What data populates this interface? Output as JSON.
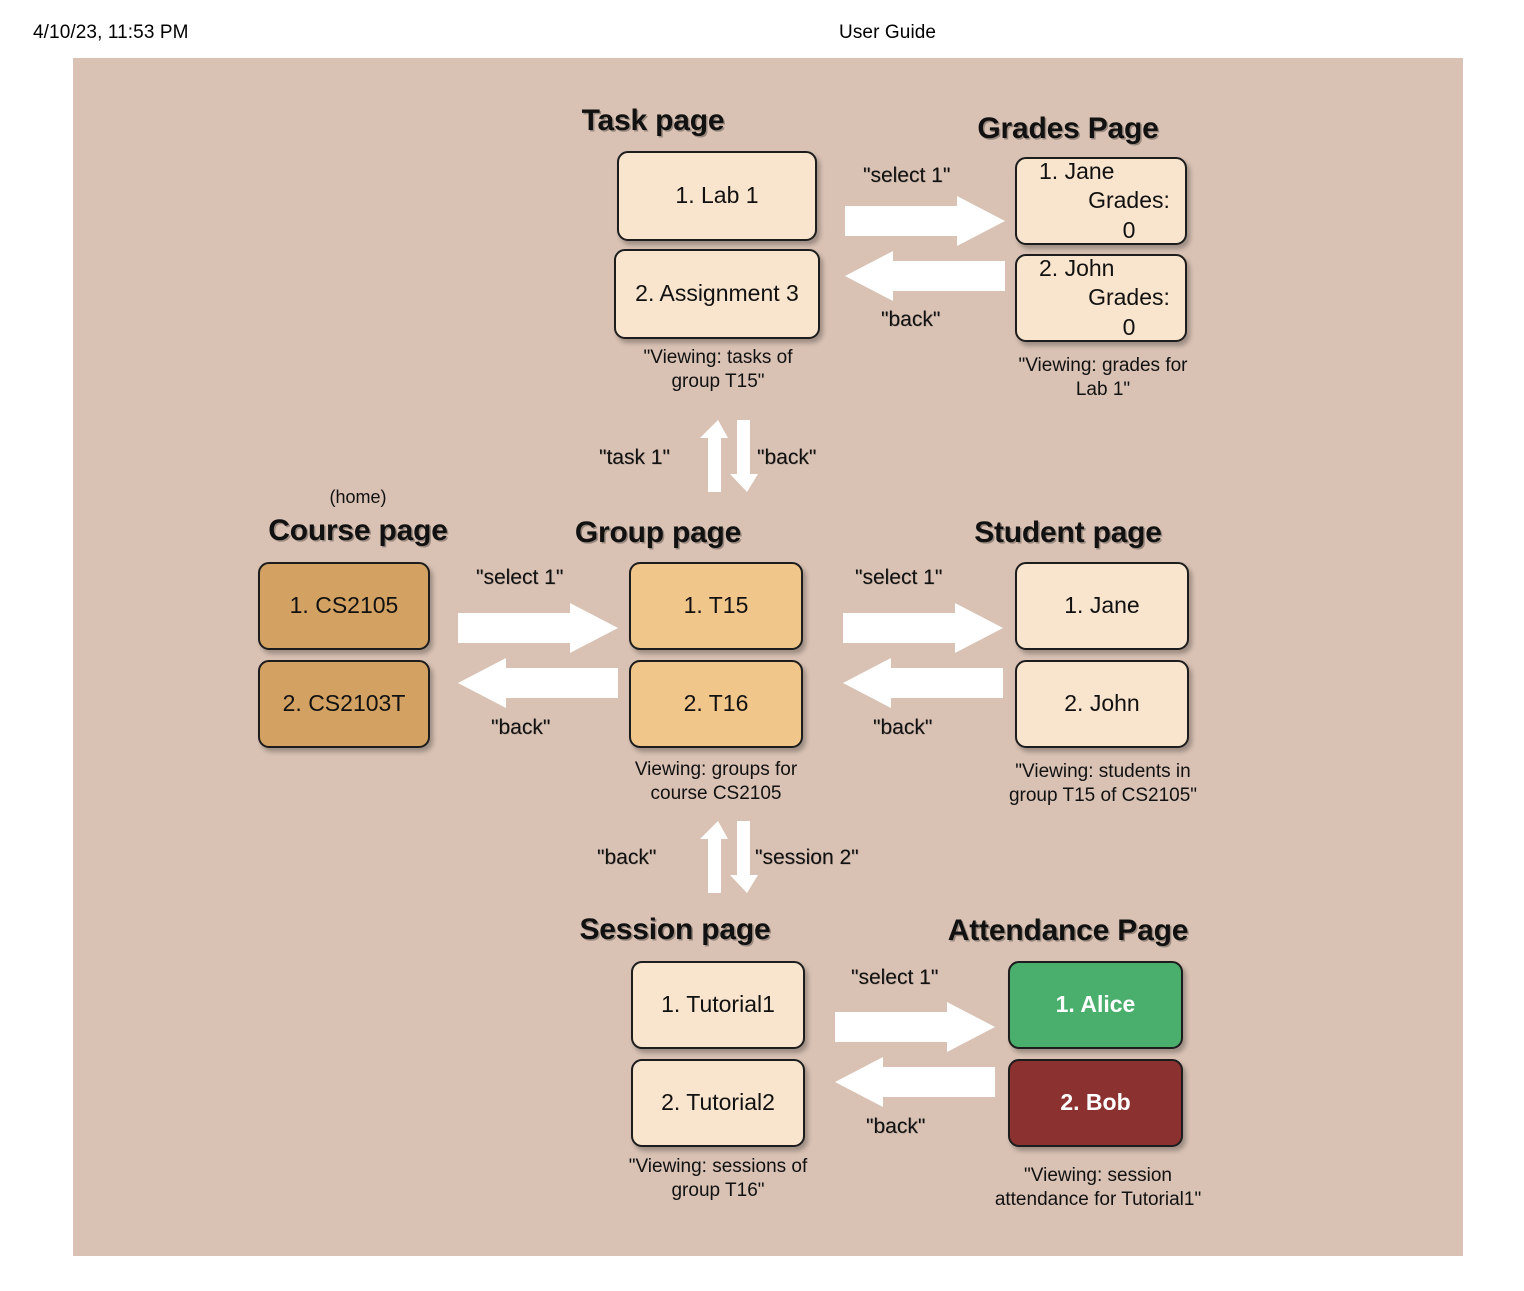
{
  "header": {
    "date": "4/10/23, 11:53 PM",
    "title": "User Guide"
  },
  "colors": {
    "panel_background": "#d9c2b4",
    "box_cream": "#f9e4cd",
    "box_tan": "#f1c68a",
    "box_brown": "#d3a263",
    "box_present_green": "#4aaf6c",
    "box_absent_maroon": "#8b3231",
    "arrow_white": "#ffffff",
    "text_black": "#111111"
  },
  "pages": {
    "task": {
      "title": "Task page",
      "items": [
        "1. Lab 1",
        "2. Assignment 3"
      ],
      "caption": "\"Viewing: tasks of\ngroup T15\""
    },
    "grades": {
      "title": "Grades Page",
      "items": [
        {
          "name": "1. Jane",
          "detail": "Grades: 0"
        },
        {
          "name": "2. John",
          "detail": "Grades: 0"
        }
      ],
      "caption": "\"Viewing: grades for\nLab 1\""
    },
    "course": {
      "home_label": "(home)",
      "title": "Course page",
      "items": [
        "1. CS2105",
        "2. CS2103T"
      ]
    },
    "group": {
      "title": "Group page",
      "items": [
        "1. T15",
        "2. T16"
      ],
      "caption": "Viewing: groups for\ncourse CS2105"
    },
    "student": {
      "title": "Student page",
      "items": [
        "1. Jane",
        "2. John"
      ],
      "caption": "\"Viewing: students in\ngroup T15 of CS2105\""
    },
    "session": {
      "title": "Session page",
      "items": [
        "1. Tutorial1",
        "2. Tutorial2"
      ],
      "caption": "\"Viewing: sessions of\ngroup T16\""
    },
    "attendance": {
      "title": "Attendance Page",
      "items": [
        "1. Alice",
        "2. Bob"
      ],
      "caption": "\"Viewing: session\nattendance for Tutorial1\""
    }
  },
  "transitions": {
    "task_to_grades_forward": "\"select 1\"",
    "grades_to_task_back": "\"back\"",
    "group_to_task_up": "\"task 1\"",
    "task_to_group_down": "\"back\"",
    "course_to_group_forward": "\"select 1\"",
    "group_to_course_back": "\"back\"",
    "group_to_student_forward": "\"select 1\"",
    "student_to_group_back": "\"back\"",
    "session_to_group_up": "\"back\"",
    "group_to_session_down": "\"session 2\"",
    "session_to_attendance_forward": "\"select 1\"",
    "attendance_to_session_back": "\"back\""
  }
}
